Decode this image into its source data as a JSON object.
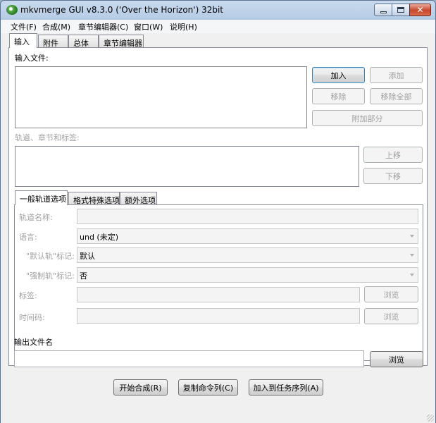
{
  "window": {
    "title": "mkvmerge GUI v8.3.0 ('Over the Horizon') 32bit"
  },
  "menu": [
    "文件(F)",
    "合成(M)",
    "章节编辑器(C)",
    "窗口(W)",
    "说明(H)"
  ],
  "tabs": [
    "输入",
    "附件",
    "总体",
    "章节编辑器"
  ],
  "input": {
    "files_label": "输入文件:",
    "add_button": "加入",
    "append_button": "添加",
    "remove_button": "移除",
    "remove_all_button": "移除全部",
    "additional_parts_button": "附加部分",
    "tracks_label": "轨道、章节和标签:",
    "move_up_button": "上移",
    "move_down_button": "下移"
  },
  "subtabs": [
    "一般轨道选项",
    "格式特殊选项",
    "额外选项"
  ],
  "track_options": {
    "track_name_label": "轨道名称:",
    "language_label": "语言:",
    "language_value": "und (未定)",
    "default_label": "\"默认轨\"标记:",
    "default_value": "默认",
    "forced_label": "\"强制轨\"标记:",
    "forced_value": "否",
    "tags_label": "标签:",
    "tags_browse": "浏览",
    "timecodes_label": "时间码:",
    "timecodes_browse": "浏览"
  },
  "output": {
    "label": "输出文件名",
    "browse_button": "浏览",
    "value": ""
  },
  "actions": {
    "start_mux": "开始合成(R)",
    "copy_cmd": "复制命令列(C)",
    "add_queue": "加入到任务序列(A)"
  }
}
